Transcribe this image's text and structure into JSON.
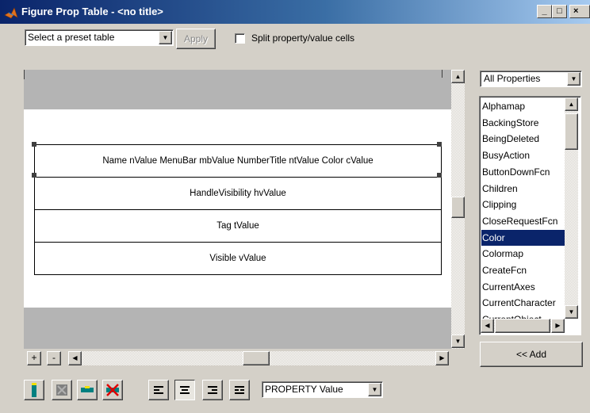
{
  "window": {
    "title": "Figure Prop Table - <no title>",
    "min_label": "_",
    "max_label": "□",
    "close_label": "×"
  },
  "toolbar_top": {
    "preset_select_value": "Select a preset table",
    "apply_label": "Apply",
    "split_checked": false,
    "split_label": "Split property/value cells"
  },
  "table": {
    "rows": [
      "Name nValue MenuBar mbValue NumberTitle ntValue Color cValue",
      "HandleVisibility hvValue",
      "Tag tValue",
      "Visible vValue"
    ],
    "plus_label": "+",
    "minus_label": "-"
  },
  "properties_panel": {
    "filter_value": "All Properties",
    "items": [
      "Alphamap",
      "BackingStore",
      "BeingDeleted",
      "BusyAction",
      "ButtonDownFcn",
      "Children",
      "Clipping",
      "CloseRequestFcn",
      "Color",
      "Colormap",
      "CreateFcn",
      "CurrentAxes",
      "CurrentCharacter",
      "CurrentObject"
    ],
    "selected": "Color",
    "add_label": "<< Add"
  },
  "bottom_toolbar": {
    "mode_value": "PROPERTY Value"
  },
  "colors": {
    "titlebar_start": "#0a246a",
    "selection": "#0a246a",
    "face": "#d4d0c8",
    "band_gray": "#b4b4b4"
  }
}
